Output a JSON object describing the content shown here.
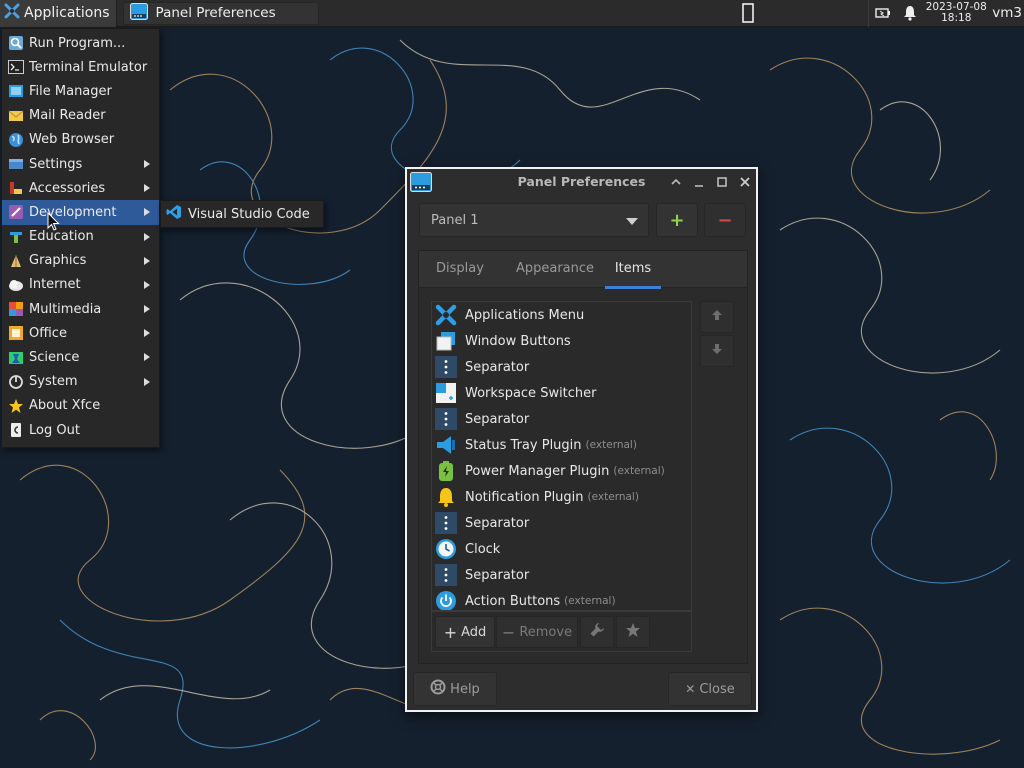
{
  "panel": {
    "applications_label": "Applications",
    "task_title": "Panel Preferences",
    "clock_date": "2023-07-08",
    "clock_time": "18:18",
    "user": "vm3"
  },
  "menu": {
    "items": [
      {
        "label": "Run Program...",
        "icon": "run-icon"
      },
      {
        "label": "Terminal Emulator",
        "icon": "terminal-icon"
      },
      {
        "label": "File Manager",
        "icon": "file-manager-icon"
      },
      {
        "label": "Mail Reader",
        "icon": "mail-icon"
      },
      {
        "label": "Web Browser",
        "icon": "web-browser-icon"
      },
      {
        "label": "Settings",
        "icon": "settings-icon",
        "submenu": true
      },
      {
        "label": "Accessories",
        "icon": "accessories-icon",
        "submenu": true
      },
      {
        "label": "Development",
        "icon": "development-icon",
        "submenu": true,
        "active": true
      },
      {
        "label": "Education",
        "icon": "education-icon",
        "submenu": true
      },
      {
        "label": "Graphics",
        "icon": "graphics-icon",
        "submenu": true
      },
      {
        "label": "Internet",
        "icon": "internet-icon",
        "submenu": true
      },
      {
        "label": "Multimedia",
        "icon": "multimedia-icon",
        "submenu": true
      },
      {
        "label": "Office",
        "icon": "office-icon",
        "submenu": true
      },
      {
        "label": "Science",
        "icon": "science-icon",
        "submenu": true
      },
      {
        "label": "System",
        "icon": "system-icon",
        "submenu": true
      },
      {
        "label": "About Xfce",
        "icon": "star-icon"
      },
      {
        "label": "Log Out",
        "icon": "logout-icon"
      }
    ],
    "submenu_item": "Visual Studio Code"
  },
  "dialog": {
    "title": "Panel Preferences",
    "panel_select_value": "Panel 1",
    "add_panel_symbol": "+",
    "remove_panel_symbol": "−",
    "tabs": [
      {
        "label": "Display",
        "active": false
      },
      {
        "label": "Appearance",
        "active": false
      },
      {
        "label": "Items",
        "active": true
      }
    ],
    "items": [
      {
        "label": "Applications Menu",
        "ext": "",
        "icon": "applications-menu-icon"
      },
      {
        "label": "Window Buttons",
        "ext": "",
        "icon": "window-buttons-icon"
      },
      {
        "label": "Separator",
        "ext": "",
        "icon": "separator-icon"
      },
      {
        "label": "Workspace Switcher",
        "ext": "",
        "icon": "workspace-switcher-icon"
      },
      {
        "label": "Separator",
        "ext": "",
        "icon": "separator-icon"
      },
      {
        "label": "Status Tray Plugin",
        "ext": "(external)",
        "icon": "status-tray-icon"
      },
      {
        "label": "Power Manager Plugin",
        "ext": "(external)",
        "icon": "battery-icon"
      },
      {
        "label": "Notification Plugin",
        "ext": "(external)",
        "icon": "bell-icon"
      },
      {
        "label": "Separator",
        "ext": "",
        "icon": "separator-icon"
      },
      {
        "label": "Clock",
        "ext": "",
        "icon": "clock-icon"
      },
      {
        "label": "Separator",
        "ext": "",
        "icon": "separator-icon"
      },
      {
        "label": "Action Buttons",
        "ext": "(external)",
        "icon": "power-icon"
      }
    ],
    "add_label": "Add",
    "remove_label": "Remove",
    "help_label": "Help",
    "close_label": "Close"
  },
  "colors": {
    "accent": "#3b82d6",
    "menu_highlight": "#2f5a99",
    "add_green": "#8fd14f",
    "remove_red": "#d14b4b"
  }
}
